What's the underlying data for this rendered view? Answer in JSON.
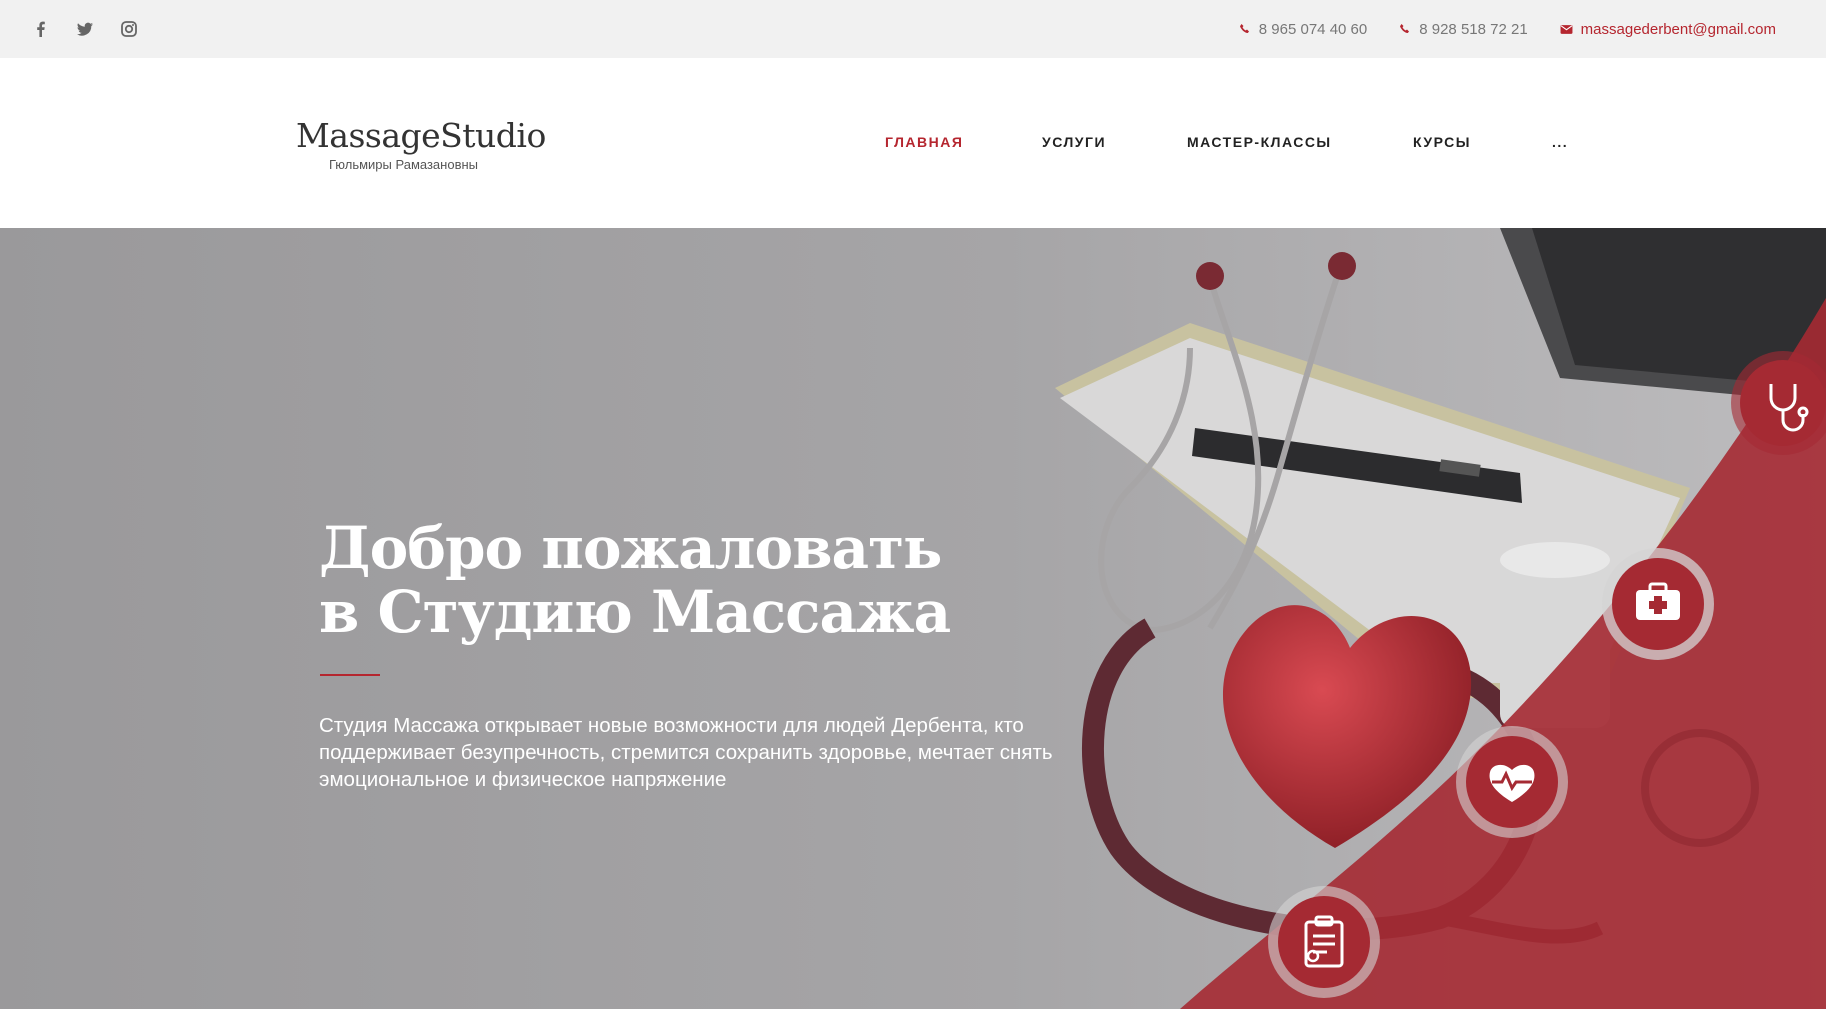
{
  "topbar": {
    "social": [
      "facebook-icon",
      "twitter-icon",
      "instagram-icon"
    ],
    "phones": [
      "8 965 074 40 60",
      "8 928 518 72 21"
    ],
    "email": "massagederbent@gmail.com"
  },
  "logo": {
    "title": "MassageStudio",
    "subtitle": "Гюльмиры Рамазановны"
  },
  "nav": {
    "items": [
      "ГЛАВНАЯ",
      "УСЛУГИ",
      "МАСТЕР-КЛАССЫ",
      "КУРСЫ",
      "..."
    ],
    "active_index": 0
  },
  "hero": {
    "title": "Добро пожаловать в Студию Массажа",
    "text": "Студия Массажа открывает новые возможности для людей Дербента, кто поддерживает безупречность, стремится сохранить здоровье, мечтает снять эмоциональное и физическое напряжение",
    "feature_icons": [
      "stethoscope-icon",
      "first-aid-kit-icon",
      "heart-pulse-icon",
      "clipboard-icon"
    ]
  },
  "colors": {
    "accent": "#b5262f",
    "topbar_bg": "#f1f1f1",
    "hero_overlay": "#9a999b",
    "hero_panel": "#a52a33"
  }
}
